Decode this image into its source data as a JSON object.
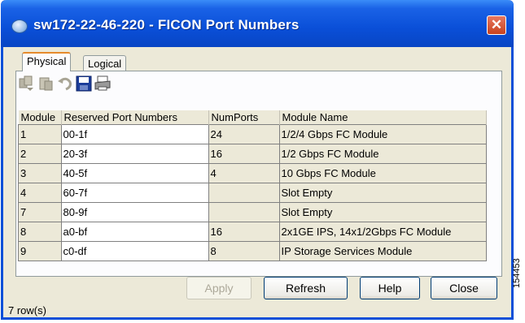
{
  "window": {
    "title": "sw172-22-46-220 - FICON Port Numbers",
    "close_glyph": "✕"
  },
  "tabs": [
    {
      "label": "Physical",
      "active": true
    },
    {
      "label": "Logical",
      "active": false
    }
  ],
  "toolbar": {
    "icons": [
      "copy-icon",
      "paste-icon",
      "undo-icon",
      "save-icon",
      "print-icon"
    ]
  },
  "table": {
    "columns": [
      "Module",
      "Reserved Port Numbers",
      "NumPorts",
      "Module Name"
    ],
    "rows": [
      [
        "1",
        "00-1f",
        "24",
        "1/2/4 Gbps FC Module"
      ],
      [
        "2",
        "20-3f",
        "16",
        "1/2 Gbps FC Module"
      ],
      [
        "3",
        "40-5f",
        "4",
        "10 Gbps FC Module"
      ],
      [
        "4",
        "60-7f",
        "",
        "Slot Empty"
      ],
      [
        "7",
        "80-9f",
        "",
        "Slot Empty"
      ],
      [
        "8",
        "a0-bf",
        "16",
        "2x1GE IPS, 14x1/2Gbps FC Module"
      ],
      [
        "9",
        "c0-df",
        "8",
        "IP Storage Services Module"
      ]
    ]
  },
  "buttons": {
    "apply": "Apply",
    "refresh": "Refresh",
    "help": "Help",
    "close": "Close"
  },
  "status": {
    "text": "7 row(s)"
  },
  "side_mark": "154453",
  "colors": {
    "titlebar": "#0a4fd8",
    "dialog_bg": "#ece9d8",
    "close_button": "#c8421e",
    "tab_highlight": "#e68b2c"
  }
}
